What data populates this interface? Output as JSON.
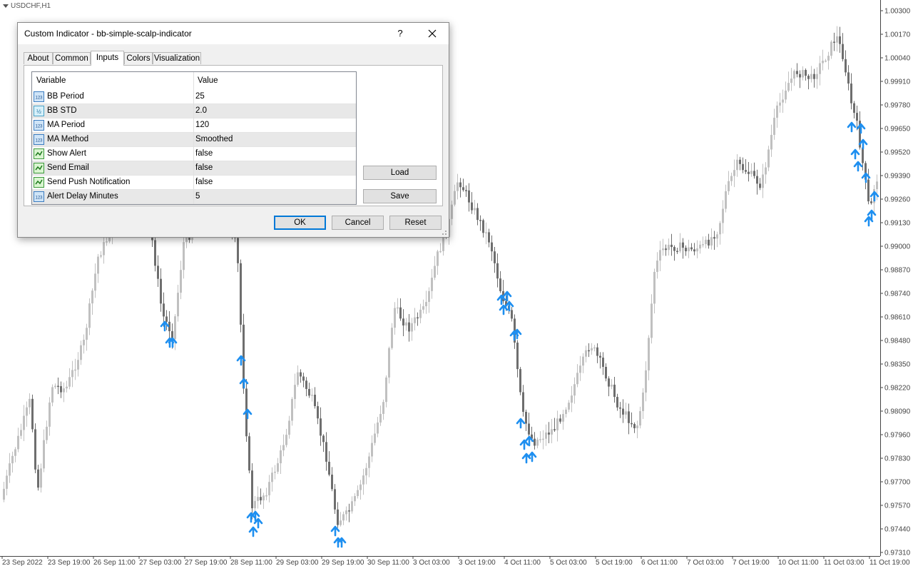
{
  "chart": {
    "symbol": "USDCHF,H1",
    "price_ticks": [
      "1.00300",
      "1.00170",
      "1.00040",
      "0.99910",
      "0.99780",
      "0.99650",
      "0.99520",
      "0.99390",
      "0.99260",
      "0.99130",
      "0.99000",
      "0.98870",
      "0.98740",
      "0.98610",
      "0.98480",
      "0.98350",
      "0.98220",
      "0.98090",
      "0.97960",
      "0.97830",
      "0.97700",
      "0.97570",
      "0.97440",
      "0.97310"
    ],
    "time_ticks": [
      "23 Sep 2022",
      "23 Sep 19:00",
      "26 Sep 11:00",
      "27 Sep 03:00",
      "27 Sep 19:00",
      "28 Sep 11:00",
      "29 Sep 03:00",
      "29 Sep 19:00",
      "30 Sep 11:00",
      "3 Oct 03:00",
      "3 Oct 19:00",
      "4 Oct 11:00",
      "5 Oct 03:00",
      "5 Oct 19:00",
      "6 Oct 11:00",
      "7 Oct 03:00",
      "7 Oct 19:00",
      "10 Oct 11:00",
      "11 Oct 03:00",
      "11 Oct 19:00"
    ],
    "colors": {
      "bull": "#c0c0c0",
      "bear": "#6e6e6e",
      "arrow": "#1e8ff0"
    }
  },
  "dialog": {
    "title": "Custom Indicator - bb-simple-scalp-indicator",
    "help_label": "?",
    "tabs": [
      {
        "label": "About"
      },
      {
        "label": "Common"
      },
      {
        "label": "Inputs"
      },
      {
        "label": "Colors"
      },
      {
        "label": "Visualization"
      }
    ],
    "active_tab": "Inputs",
    "grid": {
      "col_variable": "Variable",
      "col_value": "Value",
      "rows": [
        {
          "icon": "int-icon",
          "variable": "BB Period",
          "value": "25"
        },
        {
          "icon": "double-icon",
          "variable": "BB STD",
          "value": "2.0"
        },
        {
          "icon": "int-icon",
          "variable": "MA Period",
          "value": "120"
        },
        {
          "icon": "int-icon",
          "variable": "MA Method",
          "value": "Smoothed"
        },
        {
          "icon": "bool-icon",
          "variable": "Show Alert",
          "value": "false"
        },
        {
          "icon": "bool-icon",
          "variable": "Send Email",
          "value": "false"
        },
        {
          "icon": "bool-icon",
          "variable": "Send Push Notification",
          "value": "false"
        },
        {
          "icon": "int-icon",
          "variable": "Alert Delay Minutes",
          "value": "5"
        }
      ]
    },
    "load_label": "Load",
    "save_label": "Save",
    "ok_label": "OK",
    "cancel_label": "Cancel",
    "reset_label": "Reset"
  }
}
